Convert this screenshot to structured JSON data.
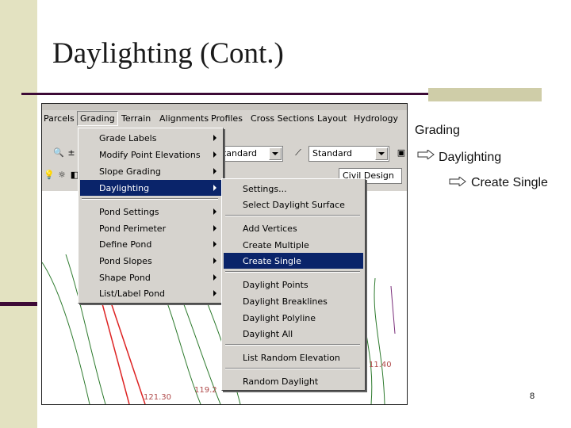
{
  "slide": {
    "title": "Daylighting (Cont.)",
    "page_number": "8",
    "bullets": [
      {
        "text": "Grading"
      },
      {
        "text": "Daylighting"
      },
      {
        "text": "Create Single"
      }
    ]
  },
  "menubar": {
    "items": [
      "Parcels",
      "Grading",
      "Terrain",
      "Alignments",
      "Profiles",
      "Cross Sections",
      "Layout",
      "Hydrology"
    ],
    "active": "Grading"
  },
  "toolbar": {
    "combo1_value": "Standard",
    "combo2_value": "Standard",
    "combo3_value": "Civil Design"
  },
  "grading_menu": {
    "items": [
      {
        "label": "Grade Labels",
        "submenu": true
      },
      {
        "label": "Modify Point Elevations",
        "submenu": true
      },
      {
        "label": "Slope Grading",
        "submenu": true
      },
      {
        "label": "Daylighting",
        "submenu": true,
        "selected": true
      },
      {
        "label": "Pond Settings",
        "submenu": true
      },
      {
        "label": "Pond Perimeter",
        "submenu": true
      },
      {
        "label": "Define Pond",
        "submenu": true
      },
      {
        "label": "Pond Slopes",
        "submenu": true
      },
      {
        "label": "Shape Pond",
        "submenu": true
      },
      {
        "label": "List/Label Pond",
        "submenu": true
      }
    ]
  },
  "daylighting_submenu": {
    "items": [
      {
        "label": "Settings..."
      },
      {
        "label": "Select Daylight Surface"
      },
      {
        "label": "Add Vertices"
      },
      {
        "label": "Create Multiple"
      },
      {
        "label": "Create Single",
        "selected": true
      },
      {
        "label": "Daylight Points"
      },
      {
        "label": "Daylight Breaklines"
      },
      {
        "label": "Daylight Polyline"
      },
      {
        "label": "Daylight All"
      },
      {
        "label": "List Random Elevation"
      },
      {
        "label": "Random Daylight"
      }
    ]
  },
  "canvas_labels": {
    "elev1": "121.30",
    "elev2": "119.2",
    "elev3": "11.40"
  },
  "colors": {
    "accent_dark": "#3d0a36",
    "sidebar": "#e3e2c1",
    "menu_highlight": "#0a246a"
  }
}
